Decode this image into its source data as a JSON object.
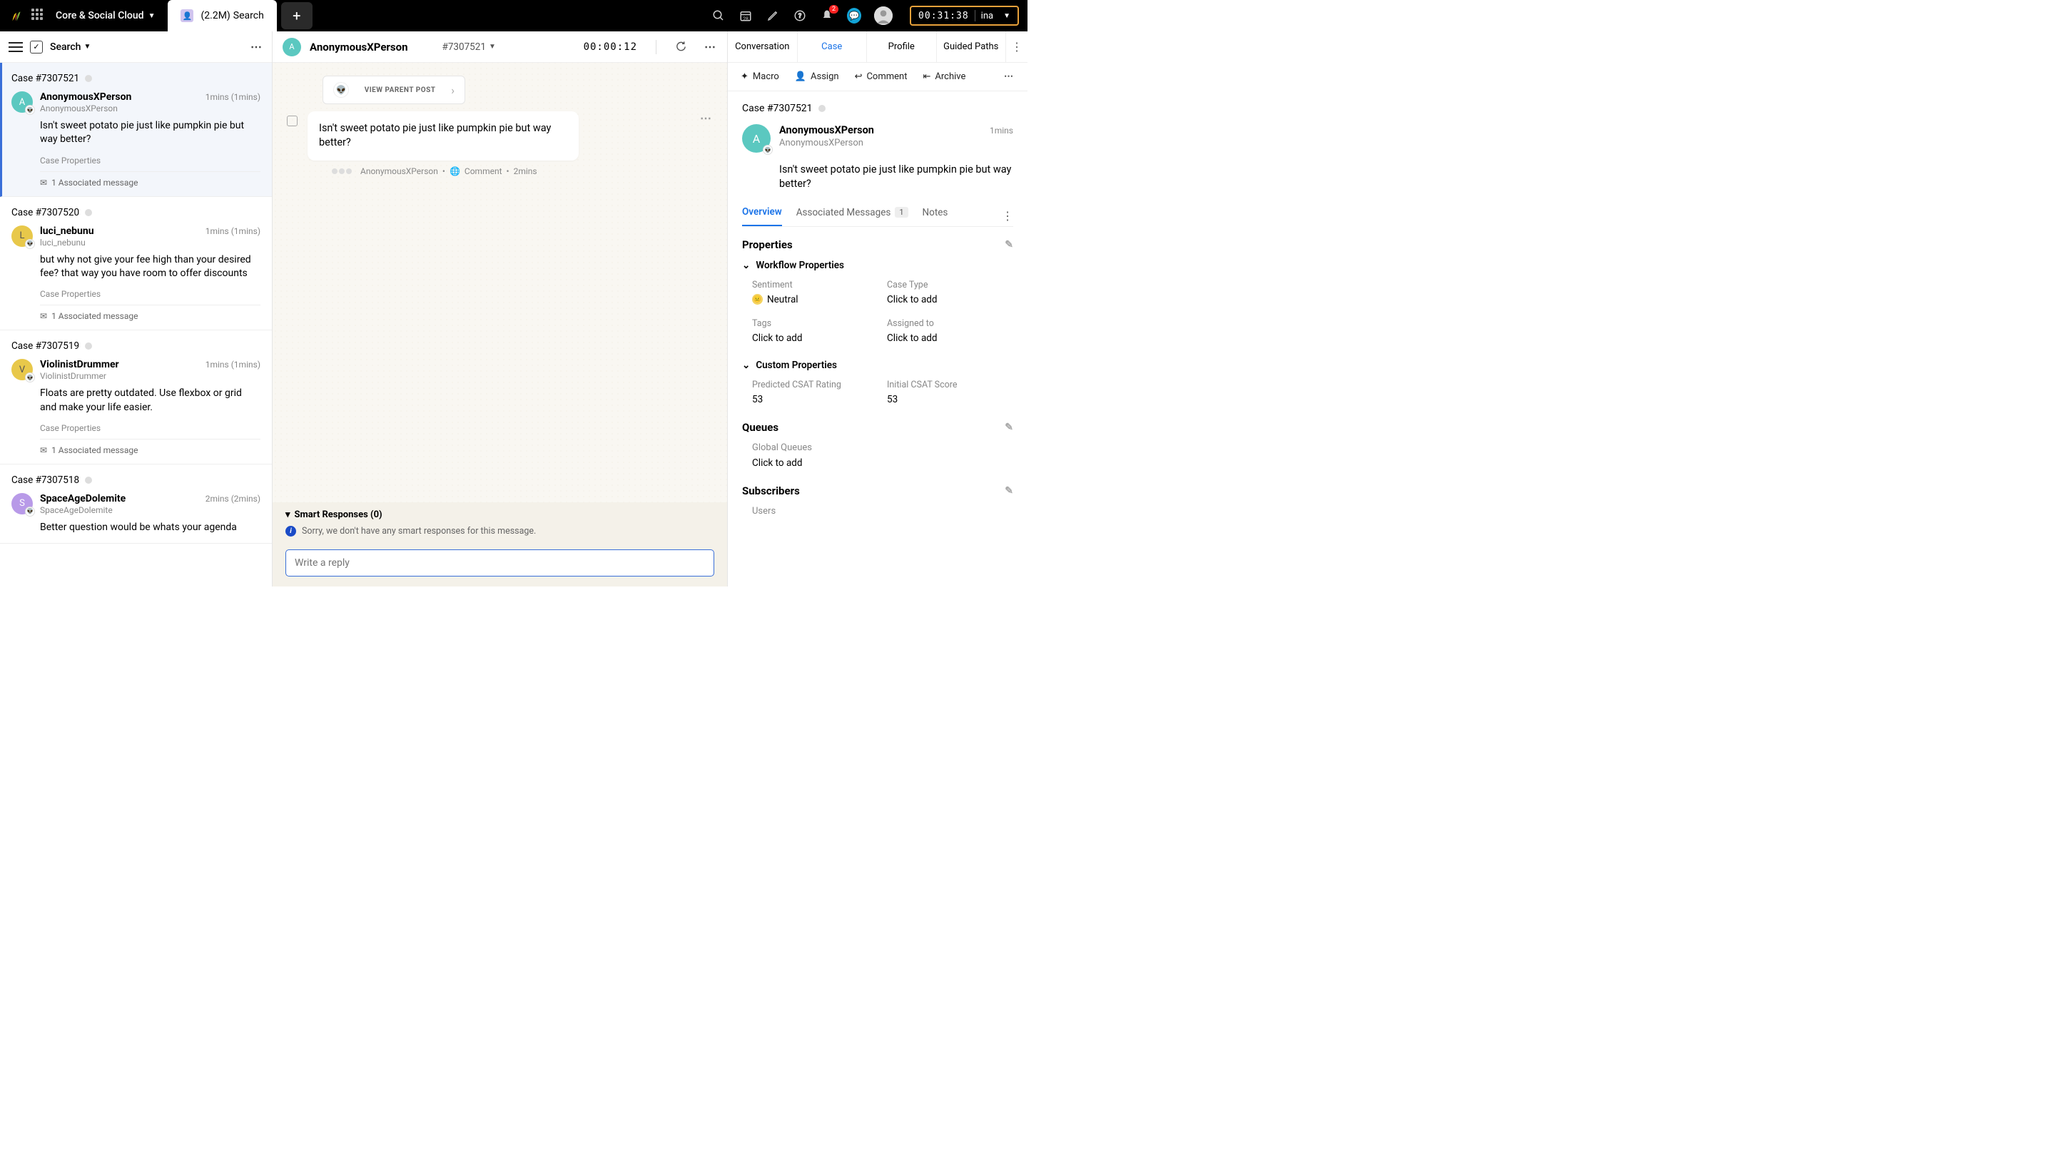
{
  "top": {
    "workspace": "Core & Social Cloud",
    "tab_count": "(2.2M)",
    "tab_label": "Search",
    "notif_count": "2",
    "timer": "00:31:38",
    "timer_who": "ina"
  },
  "search_hdr": {
    "label": "Search"
  },
  "cases": [
    {
      "id": "Case #7307521",
      "user": "AnonymousXPerson",
      "handle": "AnonymousXPerson",
      "time": "1mins  (1mins)",
      "msg": "Isn't sweet potato pie just like pumpkin pie but way better?",
      "cp": "Case Properties",
      "assoc": "1 Associated message",
      "avclass": "teal",
      "initial": "A"
    },
    {
      "id": "Case #7307520",
      "user": "luci_nebunu",
      "handle": "luci_nebunu",
      "time": "1mins  (1mins)",
      "msg": "but why not give your fee high than your desired fee? that way you have room to offer discounts",
      "cp": "Case Properties",
      "assoc": "1 Associated message",
      "avclass": "yellow",
      "initial": "L"
    },
    {
      "id": "Case #7307519",
      "user": "ViolinistDrummer",
      "handle": "ViolinistDrummer",
      "time": "1mins  (1mins)",
      "msg": "Floats are pretty outdated. Use flexbox or grid and make your life easier.",
      "cp": "Case Properties",
      "assoc": "1 Associated message",
      "avclass": "yellow",
      "initial": "V"
    },
    {
      "id": "Case #7307518",
      "user": "SpaceAgeDolemite",
      "handle": "SpaceAgeDolemite",
      "time": "2mins  (2mins)",
      "msg": "Better question would be whats your agenda",
      "cp": "",
      "assoc": "",
      "avclass": "purple",
      "initial": "S"
    }
  ],
  "mid": {
    "user": "AnonymousXPerson",
    "case": "#7307521",
    "timer": "00:00:12",
    "parent": "VIEW PARENT POST",
    "bubble": "Isn't sweet potato pie just like pumpkin pie but way better?",
    "meta_user": "AnonymousXPerson",
    "meta_type": "Comment",
    "meta_time": "2mins",
    "smart_hdr": "Smart Responses (0)",
    "smart_body": "Sorry, we don't have any smart responses for this message.",
    "reply_ph": "Write a reply"
  },
  "right": {
    "tabs": [
      "Conversation",
      "Case",
      "Profile",
      "Guided Paths"
    ],
    "actions": {
      "macro": "Macro",
      "assign": "Assign",
      "comment": "Comment",
      "archive": "Archive"
    },
    "case": "Case #7307521",
    "user": "AnonymousXPerson",
    "handle": "AnonymousXPerson",
    "time": "1mins",
    "msg": "Isn't sweet potato pie just like pumpkin pie but way better?",
    "subtabs": {
      "overview": "Overview",
      "assoc": "Associated Messages",
      "assoc_count": "1",
      "notes": "Notes"
    },
    "props_hdr": "Properties",
    "workflow_hdr": "Workflow Properties",
    "workflow": {
      "sentiment_lbl": "Sentiment",
      "sentiment_val": "Neutral",
      "casetype_lbl": "Case Type",
      "casetype_val": "Click to add",
      "tags_lbl": "Tags",
      "tags_val": "Click to add",
      "assigned_lbl": "Assigned to",
      "assigned_val": "Click to add"
    },
    "custom_hdr": "Custom Properties",
    "custom": {
      "csat_lbl": "Predicted CSAT Rating",
      "csat_val": "53",
      "init_lbl": "Initial CSAT Score",
      "init_val": "53"
    },
    "queues_hdr": "Queues",
    "queues": {
      "global_lbl": "Global Queues",
      "global_val": "Click to add"
    },
    "subs_hdr": "Subscribers",
    "subs_users": "Users"
  }
}
